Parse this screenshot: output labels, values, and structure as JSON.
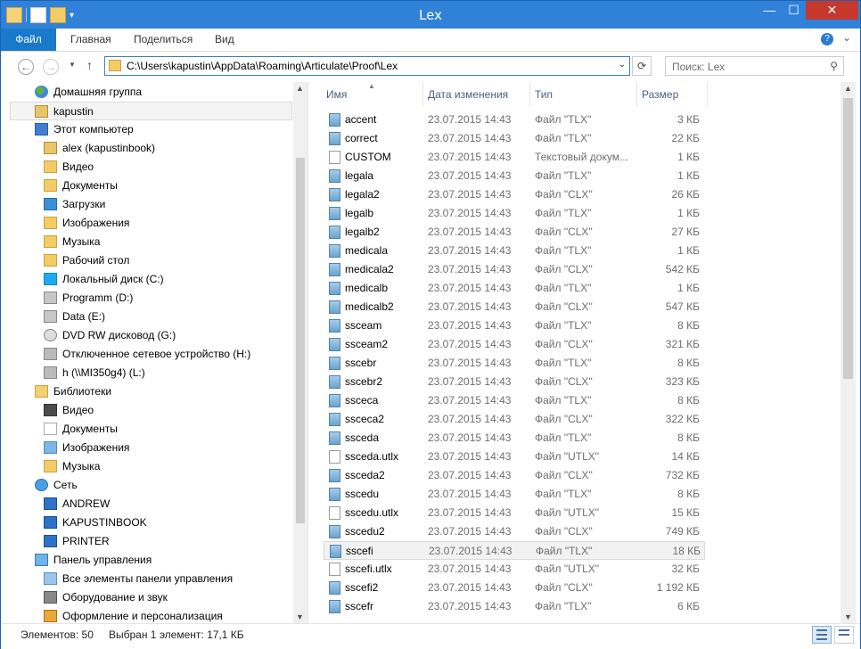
{
  "window": {
    "title": "Lex"
  },
  "ribbon": {
    "file": "Файл",
    "home": "Главная",
    "share": "Поделиться",
    "view": "Вид"
  },
  "address": {
    "path": "C:\\Users\\kapustin\\AppData\\Roaming\\Articulate\\Proof\\Lex"
  },
  "search": {
    "placeholder": "Поиск: Lex"
  },
  "columns": {
    "name": "Имя",
    "date": "Дата изменения",
    "type": "Тип",
    "size": "Размер"
  },
  "nav": [
    {
      "label": "Домашняя группа",
      "icon": "homegroup-icon",
      "cls": "group",
      "indent": 1
    },
    {
      "label": "kapustin",
      "icon": "user-folder-icon",
      "cls": "user",
      "indent": 1,
      "selected": true
    },
    {
      "label": "Этот компьютер",
      "icon": "computer-icon",
      "cls": "pc",
      "indent": 1
    },
    {
      "label": "alex (kapustinbook)",
      "icon": "network-user-icon",
      "cls": "user",
      "indent": 2
    },
    {
      "label": "Видео",
      "icon": "video-folder-icon",
      "cls": "folder",
      "indent": 2
    },
    {
      "label": "Документы",
      "icon": "documents-folder-icon",
      "cls": "folder",
      "indent": 2
    },
    {
      "label": "Загрузки",
      "icon": "downloads-folder-icon",
      "cls": "down",
      "indent": 2
    },
    {
      "label": "Изображения",
      "icon": "pictures-folder-icon",
      "cls": "folder",
      "indent": 2
    },
    {
      "label": "Музыка",
      "icon": "music-folder-icon",
      "cls": "folder",
      "indent": 2
    },
    {
      "label": "Рабочий стол",
      "icon": "desktop-folder-icon",
      "cls": "folder",
      "indent": 2
    },
    {
      "label": "Локальный диск (C:)",
      "icon": "windows-drive-icon",
      "cls": "win",
      "indent": 2
    },
    {
      "label": "Programm (D:)",
      "icon": "drive-icon",
      "cls": "drive",
      "indent": 2
    },
    {
      "label": "Data (E:)",
      "icon": "drive-icon",
      "cls": "drive",
      "indent": 2
    },
    {
      "label": "DVD RW дисковод (G:)",
      "icon": "dvd-drive-icon",
      "cls": "dvd",
      "indent": 2
    },
    {
      "label": "Отключенное сетевое устройство (H:)",
      "icon": "network-drive-disconnected-icon",
      "cls": "netx",
      "indent": 2
    },
    {
      "label": "h (\\\\MI350g4) (L:)",
      "icon": "network-drive-disconnected-icon",
      "cls": "netx",
      "indent": 2
    },
    {
      "label": "Библиотеки",
      "icon": "libraries-icon",
      "cls": "lib",
      "indent": 1
    },
    {
      "label": "Видео",
      "icon": "video-library-icon",
      "cls": "video",
      "indent": 2
    },
    {
      "label": "Документы",
      "icon": "documents-library-icon",
      "cls": "note",
      "indent": 2
    },
    {
      "label": "Изображения",
      "icon": "pictures-library-icon",
      "cls": "img",
      "indent": 2
    },
    {
      "label": "Музыка",
      "icon": "music-library-icon",
      "cls": "music",
      "indent": 2
    },
    {
      "label": "Сеть",
      "icon": "network-icon",
      "cls": "net",
      "indent": 1
    },
    {
      "label": "ANDREW",
      "icon": "network-computer-icon",
      "cls": "mon",
      "indent": 2
    },
    {
      "label": "KAPUSTINBOOK",
      "icon": "network-computer-icon",
      "cls": "mon",
      "indent": 2
    },
    {
      "label": "PRINTER",
      "icon": "network-computer-icon",
      "cls": "mon",
      "indent": 2
    },
    {
      "label": "Панель управления",
      "icon": "control-panel-icon",
      "cls": "cp",
      "indent": 1
    },
    {
      "label": "Все элементы панели управления",
      "icon": "control-panel-items-icon",
      "cls": "cp2",
      "indent": 2
    },
    {
      "label": "Оборудование и звук",
      "icon": "hardware-sound-icon",
      "cls": "audio",
      "indent": 2
    },
    {
      "label": "Оформление и персонализация",
      "icon": "personalization-icon",
      "cls": "paint",
      "indent": 2
    }
  ],
  "files": [
    {
      "name": "accent",
      "date": "23.07.2015 14:43",
      "type": "Файл \"TLX\"",
      "size": "3 КБ",
      "kind": "tlx"
    },
    {
      "name": "correct",
      "date": "23.07.2015 14:43",
      "type": "Файл \"TLX\"",
      "size": "22 КБ",
      "kind": "tlx"
    },
    {
      "name": "CUSTOM",
      "date": "23.07.2015 14:43",
      "type": "Текстовый докум...",
      "size": "1 КБ",
      "kind": "txt"
    },
    {
      "name": "legala",
      "date": "23.07.2015 14:43",
      "type": "Файл \"TLX\"",
      "size": "1 КБ",
      "kind": "tlx"
    },
    {
      "name": "legala2",
      "date": "23.07.2015 14:43",
      "type": "Файл \"CLX\"",
      "size": "26 КБ",
      "kind": "tlx"
    },
    {
      "name": "legalb",
      "date": "23.07.2015 14:43",
      "type": "Файл \"TLX\"",
      "size": "1 КБ",
      "kind": "tlx"
    },
    {
      "name": "legalb2",
      "date": "23.07.2015 14:43",
      "type": "Файл \"CLX\"",
      "size": "27 КБ",
      "kind": "tlx"
    },
    {
      "name": "medicala",
      "date": "23.07.2015 14:43",
      "type": "Файл \"TLX\"",
      "size": "1 КБ",
      "kind": "tlx"
    },
    {
      "name": "medicala2",
      "date": "23.07.2015 14:43",
      "type": "Файл \"CLX\"",
      "size": "542 КБ",
      "kind": "tlx"
    },
    {
      "name": "medicalb",
      "date": "23.07.2015 14:43",
      "type": "Файл \"TLX\"",
      "size": "1 КБ",
      "kind": "tlx"
    },
    {
      "name": "medicalb2",
      "date": "23.07.2015 14:43",
      "type": "Файл \"CLX\"",
      "size": "547 КБ",
      "kind": "tlx"
    },
    {
      "name": "ssceam",
      "date": "23.07.2015 14:43",
      "type": "Файл \"TLX\"",
      "size": "8 КБ",
      "kind": "tlx"
    },
    {
      "name": "ssceam2",
      "date": "23.07.2015 14:43",
      "type": "Файл \"CLX\"",
      "size": "321 КБ",
      "kind": "tlx"
    },
    {
      "name": "sscebr",
      "date": "23.07.2015 14:43",
      "type": "Файл \"TLX\"",
      "size": "8 КБ",
      "kind": "tlx"
    },
    {
      "name": "sscebr2",
      "date": "23.07.2015 14:43",
      "type": "Файл \"CLX\"",
      "size": "323 КБ",
      "kind": "tlx"
    },
    {
      "name": "ssceca",
      "date": "23.07.2015 14:43",
      "type": "Файл \"TLX\"",
      "size": "8 КБ",
      "kind": "tlx"
    },
    {
      "name": "ssceca2",
      "date": "23.07.2015 14:43",
      "type": "Файл \"CLX\"",
      "size": "322 КБ",
      "kind": "tlx"
    },
    {
      "name": "ssceda",
      "date": "23.07.2015 14:43",
      "type": "Файл \"TLX\"",
      "size": "8 КБ",
      "kind": "tlx"
    },
    {
      "name": "ssceda.utlx",
      "date": "23.07.2015 14:43",
      "type": "Файл \"UTLX\"",
      "size": "14 КБ",
      "kind": "txt"
    },
    {
      "name": "ssceda2",
      "date": "23.07.2015 14:43",
      "type": "Файл \"CLX\"",
      "size": "732 КБ",
      "kind": "tlx"
    },
    {
      "name": "sscedu",
      "date": "23.07.2015 14:43",
      "type": "Файл \"TLX\"",
      "size": "8 КБ",
      "kind": "tlx"
    },
    {
      "name": "sscedu.utlx",
      "date": "23.07.2015 14:43",
      "type": "Файл \"UTLX\"",
      "size": "15 КБ",
      "kind": "txt"
    },
    {
      "name": "sscedu2",
      "date": "23.07.2015 14:43",
      "type": "Файл \"CLX\"",
      "size": "749 КБ",
      "kind": "tlx"
    },
    {
      "name": "sscefi",
      "date": "23.07.2015 14:43",
      "type": "Файл \"TLX\"",
      "size": "18 КБ",
      "kind": "tlx",
      "selected": true
    },
    {
      "name": "sscefi.utlx",
      "date": "23.07.2015 14:43",
      "type": "Файл \"UTLX\"",
      "size": "32 КБ",
      "kind": "txt"
    },
    {
      "name": "sscefi2",
      "date": "23.07.2015 14:43",
      "type": "Файл \"CLX\"",
      "size": "1 192 КБ",
      "kind": "tlx"
    },
    {
      "name": "sscefr",
      "date": "23.07.2015 14:43",
      "type": "Файл \"TLX\"",
      "size": "6 КБ",
      "kind": "tlx"
    }
  ],
  "status": {
    "count": "Элементов: 50",
    "selected": "Выбран 1 элемент: 17,1 КБ"
  }
}
